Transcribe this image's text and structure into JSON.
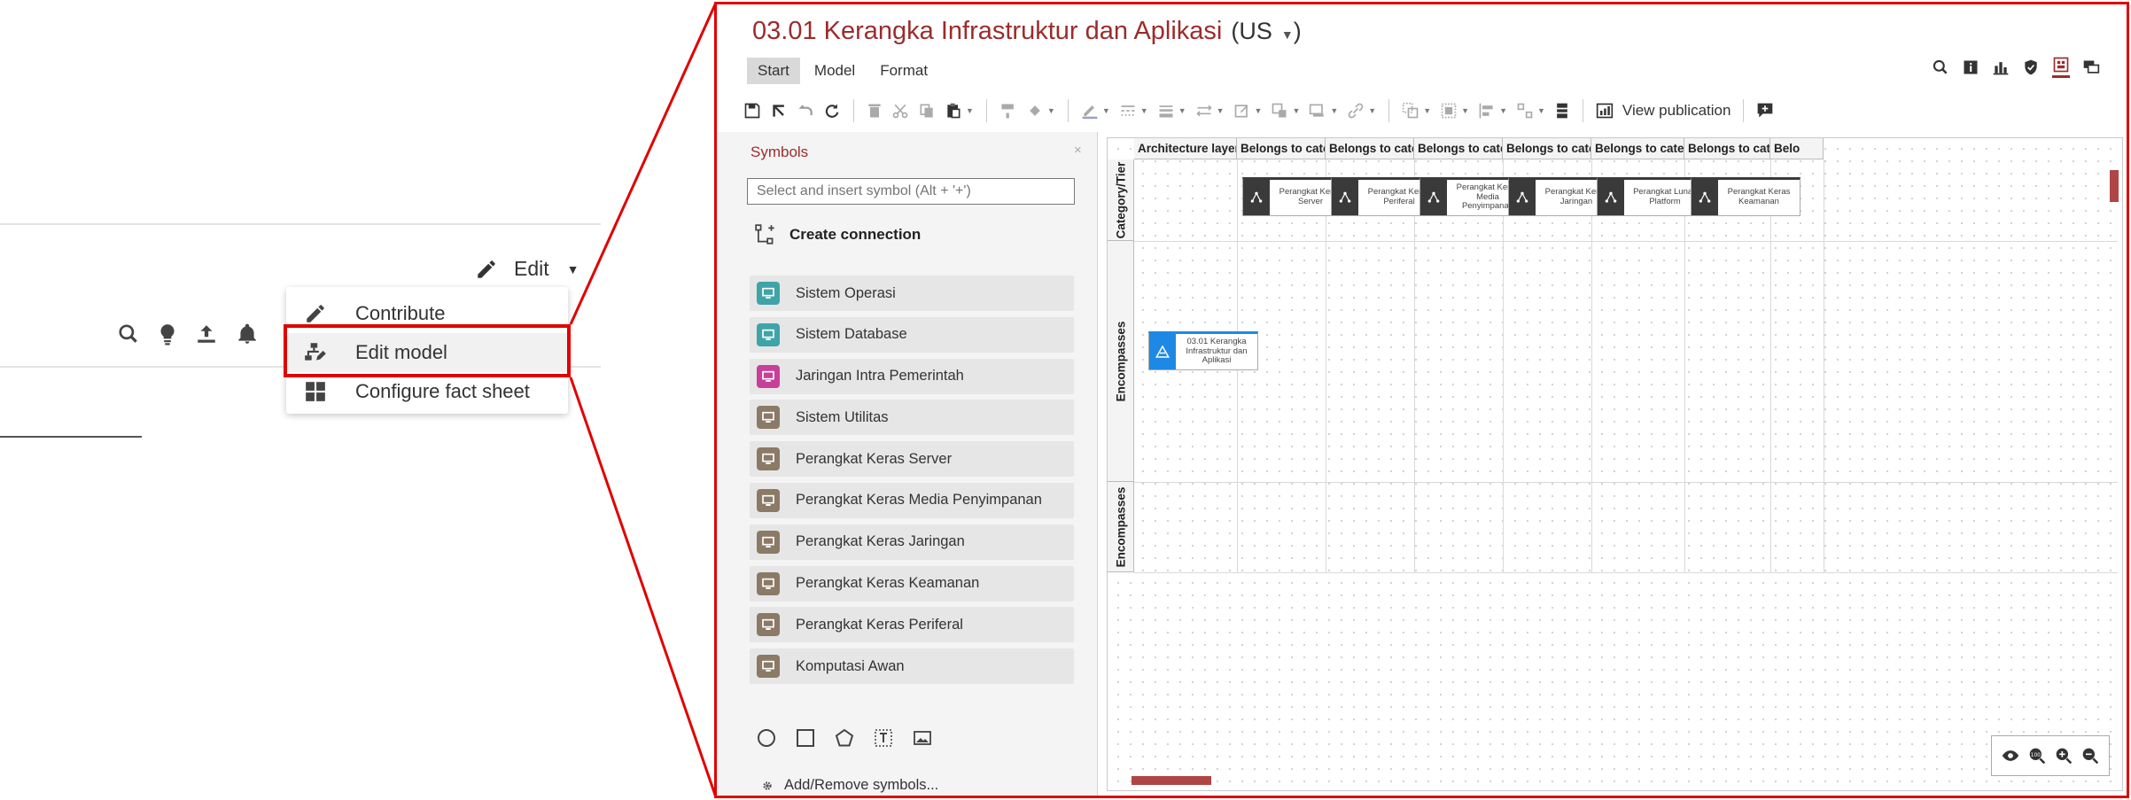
{
  "left": {
    "edit_label": "Edit",
    "menu": [
      {
        "label": "Contribute",
        "icon": "pencil-icon"
      },
      {
        "label": "Edit model",
        "icon": "edit-model-icon"
      },
      {
        "label": "Configure fact sheet",
        "icon": "grid-icon"
      }
    ],
    "toolbar_icons": [
      "search-icon",
      "lightbulb-icon",
      "upload-icon",
      "bell-icon"
    ]
  },
  "app": {
    "title": "03.01 Kerangka Infrastruktur dan Aplikasi",
    "language": "(US",
    "tabs": [
      {
        "label": "Start",
        "active": true
      },
      {
        "label": "Model",
        "active": false
      },
      {
        "label": "Format",
        "active": false
      }
    ],
    "toolbar": {
      "view_publication": "View publication"
    },
    "symbols": {
      "heading": "Symbols",
      "close": "×",
      "search_placeholder": "Select and insert symbol (Alt + '+')",
      "create_connection": "Create connection",
      "items": [
        {
          "label": "Sistem Operasi",
          "color": "#3fa4a8"
        },
        {
          "label": "Sistem Database",
          "color": "#3fa4a8"
        },
        {
          "label": "Jaringan Intra Pemerintah",
          "color": "#c83f9a"
        },
        {
          "label": "Sistem Utilitas",
          "color": "#8a7a66"
        },
        {
          "label": "Perangkat Keras Server",
          "color": "#8a7a66"
        },
        {
          "label": "Perangkat Keras Media Penyimpanan",
          "color": "#8a7a66"
        },
        {
          "label": "Perangkat Keras Jaringan",
          "color": "#8a7a66"
        },
        {
          "label": "Perangkat Keras Keamanan",
          "color": "#8a7a66"
        },
        {
          "label": "Perangkat Keras Periferal",
          "color": "#8a7a66"
        },
        {
          "label": "Komputasi Awan",
          "color": "#8a7a66"
        }
      ],
      "add_remove": "Add/Remove symbols..."
    },
    "canvas": {
      "columns": [
        "Architecture layer/ele...",
        "Belongs to category/t...",
        "Belongs to category/tier",
        "Belongs to category/t...",
        "Belongs to category/t...",
        "Belongs to category/tier",
        "Belongs to category/t...",
        "Belo"
      ],
      "rows": [
        "Category/Tier",
        "Encompasses",
        "Encompasses"
      ],
      "category_nodes": [
        "Perangkat Keras Server",
        "Perangkat Keras Periferal",
        "Perangkat Keras Media Penyimpanan",
        "Perangkat Keras Jaringan",
        "Perangkat Lunak Platform",
        "Perangkat Keras Keamanan"
      ],
      "main_node": "03.01 Kerangka Infrastruktur dan Aplikasi"
    }
  }
}
